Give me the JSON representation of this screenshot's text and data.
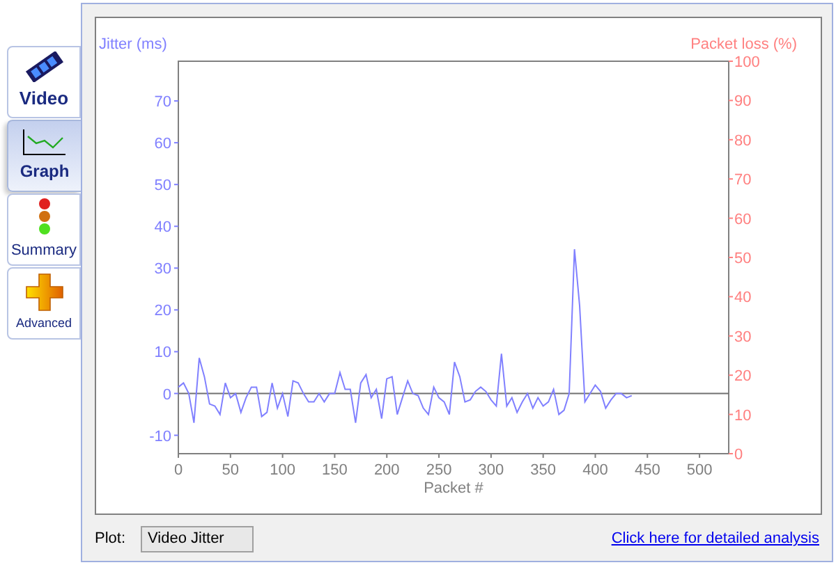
{
  "tabs": [
    {
      "label": "Video",
      "kind": "video",
      "selected": false
    },
    {
      "label": "Graph",
      "kind": "graph",
      "selected": true
    },
    {
      "label": "Summary",
      "kind": "summary",
      "selected": false
    },
    {
      "label": "Advanced",
      "kind": "advanced",
      "selected": false
    }
  ],
  "chart": {
    "chart_data": {
      "type": "line",
      "xlabel": "Packet #",
      "y2label": "Packet loss (%)",
      "x": [
        0,
        5,
        10,
        15,
        20,
        25,
        30,
        35,
        40,
        45,
        50,
        55,
        60,
        65,
        70,
        75,
        80,
        85,
        90,
        95,
        100,
        105,
        110,
        115,
        120,
        125,
        130,
        135,
        140,
        145,
        150,
        155,
        160,
        165,
        170,
        175,
        180,
        185,
        190,
        195,
        200,
        205,
        210,
        215,
        220,
        225,
        230,
        235,
        240,
        245,
        250,
        255,
        260,
        265,
        270,
        275,
        280,
        285,
        290,
        295,
        300,
        305,
        310,
        315,
        320,
        325,
        330,
        335,
        340,
        345,
        350,
        355,
        360,
        365,
        370,
        375,
        380,
        385,
        390,
        395,
        400,
        405,
        410,
        415,
        420,
        425,
        430,
        435
      ],
      "series": [
        {
          "name": "Jitter (ms)",
          "color": "#8080ff",
          "values": [
            1.5,
            2.5,
            0,
            -7,
            8.5,
            4,
            -2.5,
            -3,
            -5,
            2.5,
            -1,
            0,
            -4.5,
            -1,
            1.5,
            1.5,
            -5.5,
            -4.5,
            2.5,
            -3.5,
            0,
            -5.5,
            3,
            2.5,
            0,
            -2,
            -2,
            0,
            -2,
            0,
            0,
            5,
            1,
            1,
            -7,
            2.5,
            4.5,
            -1,
            1,
            -6,
            3.5,
            4,
            -5,
            -1,
            3,
            0,
            -0.5,
            -3.5,
            -5,
            1.5,
            -1,
            -2,
            -5,
            7.5,
            4,
            -2,
            -1.5,
            0.5,
            1.5,
            0.5,
            -1.5,
            -3,
            9.5,
            -3,
            -1,
            -4.5,
            -2,
            0,
            -3.5,
            -1,
            -3,
            -2,
            1,
            -5,
            -4,
            0,
            34.5,
            21,
            -2,
            0,
            2,
            0.5,
            -3.5,
            -1.5,
            0,
            0,
            -1,
            -0.5
          ]
        }
      ],
      "xlim": [
        0,
        528
      ],
      "ylim": [
        -14.4,
        79.5
      ],
      "xticks": [
        0,
        50,
        100,
        150,
        200,
        250,
        300,
        350,
        400,
        450,
        500
      ],
      "yticks": [
        -10,
        0,
        10,
        20,
        30,
        40,
        50,
        60,
        70
      ],
      "y2lim": [
        0,
        100
      ],
      "y2ticks": [
        0,
        10,
        20,
        30,
        40,
        50,
        60,
        70,
        80,
        90,
        100
      ]
    }
  },
  "plot_selector": {
    "label": "Plot:",
    "value": "Video Jitter"
  },
  "link": "Click here for detailed analysis"
}
